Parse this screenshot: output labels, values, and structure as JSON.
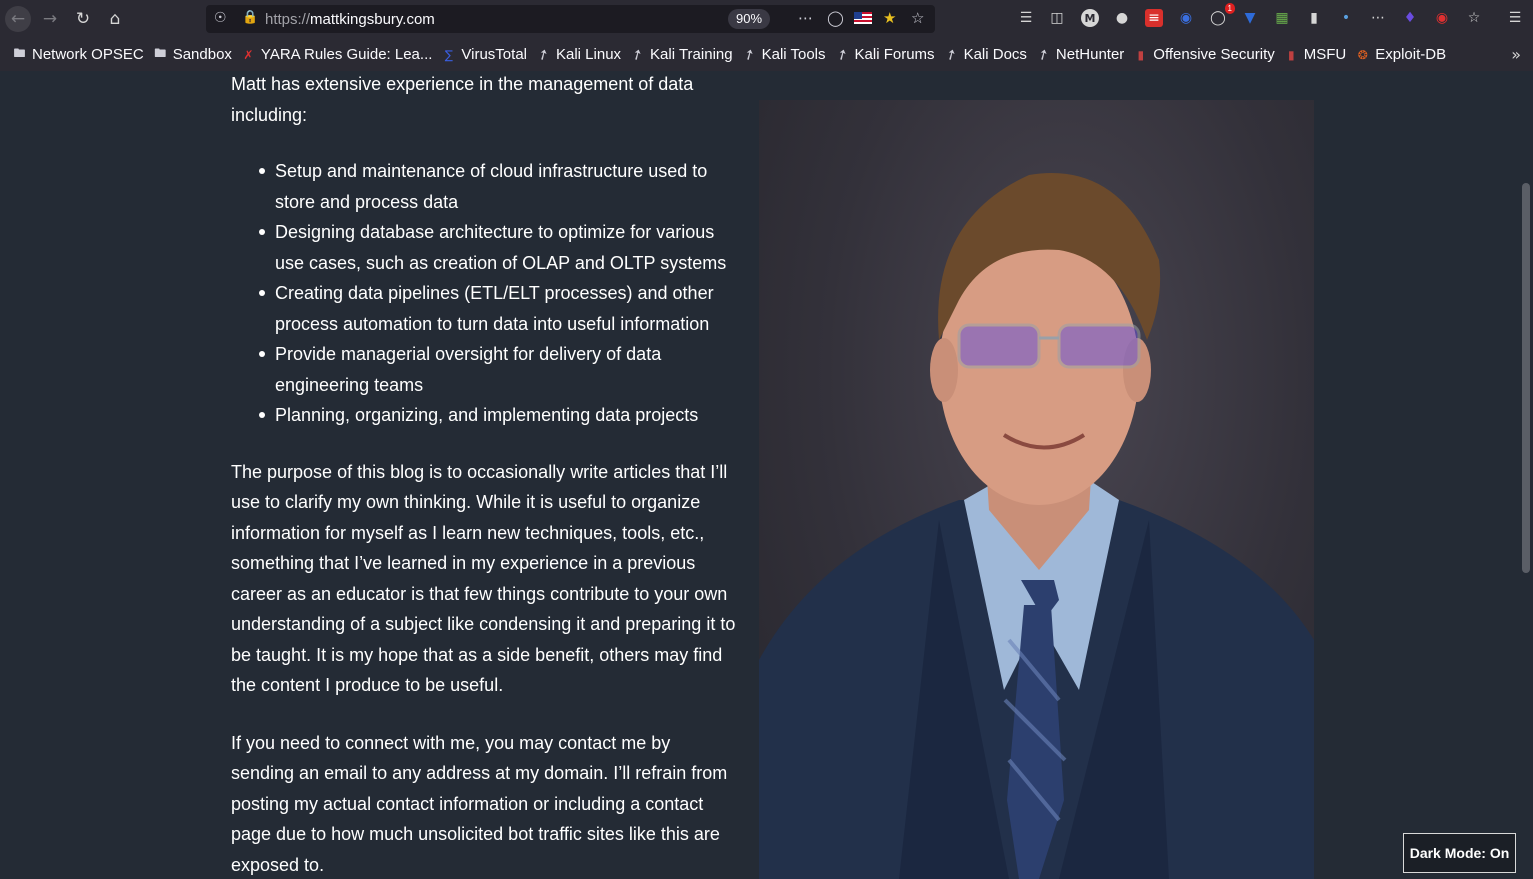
{
  "browser": {
    "url_protocol": "https://",
    "url_host": "mattkingsbury.com",
    "zoom": "90%",
    "notification_badge": "1"
  },
  "bookmarks": [
    {
      "label": "Network OPSEC",
      "icon": "folder-icon"
    },
    {
      "label": "Sandbox",
      "icon": "folder-icon"
    },
    {
      "label": "YARA Rules Guide: Lea...",
      "icon": "yara-icon"
    },
    {
      "label": "VirusTotal",
      "icon": "virustotal-icon"
    },
    {
      "label": "Kali Linux",
      "icon": "kali-dragon-icon"
    },
    {
      "label": "Kali Training",
      "icon": "kali-dragon-icon"
    },
    {
      "label": "Kali Tools",
      "icon": "kali-dragon-icon"
    },
    {
      "label": "Kali Forums",
      "icon": "kali-dragon-icon"
    },
    {
      "label": "Kali Docs",
      "icon": "kali-dragon-icon"
    },
    {
      "label": "NetHunter",
      "icon": "kali-dragon-icon"
    },
    {
      "label": "Offensive Security",
      "icon": "offsec-icon"
    },
    {
      "label": "MSFU",
      "icon": "offsec-icon"
    },
    {
      "label": "Exploit-DB",
      "icon": "exploitdb-icon"
    }
  ],
  "page": {
    "intro": "Matt has extensive experience in the management of data including:",
    "bullets": [
      "Setup and maintenance of cloud infrastructure used to store and process data",
      "Designing database architecture to optimize for various use cases, such as creation of OLAP and OLTP systems",
      "Creating data pipelines (ETL/ELT processes) and other process automation to turn data into useful information",
      "Provide managerial oversight for delivery of data engineering teams",
      "Planning, organizing, and implementing data projects"
    ],
    "blog_paragraph": "The purpose of this blog is to occasionally write articles that I’ll use to clarify my own thinking. While it is useful to organize information for myself as I learn new techniques, tools, etc., something that I’ve learned in my experience in a previous career as an educator is that few things contribute to your own understanding of a subject like condensing it and preparing it to be taught. It is my hope that as a side benefit, others may find the content I produce to be useful.",
    "contact_paragraph": "If you need to connect with me, you may contact me by sending an email to any address at my domain. I’ll refrain from posting my actual contact information or including a contact page due to how much unsolicited bot traffic sites like this are exposed to."
  },
  "dark_mode_toggle": "Dark Mode: On",
  "colors": {
    "page_bg": "#242b35",
    "text": "#ffffff",
    "toolbar_bg": "#2b2a33",
    "suit": "#22304a",
    "shirt": "#9fb8d8"
  }
}
